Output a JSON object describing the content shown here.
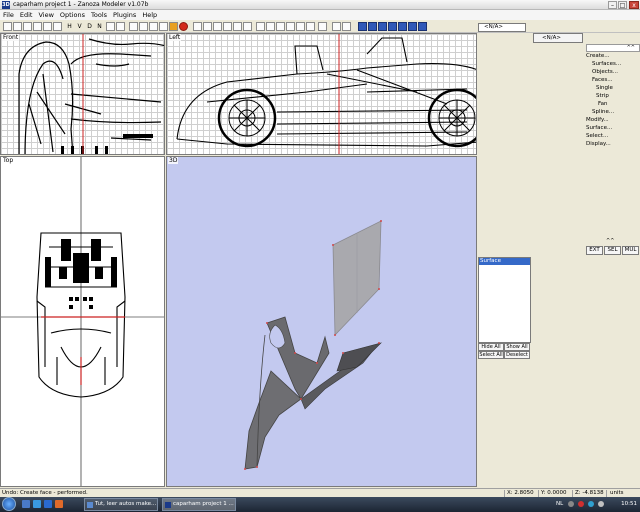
{
  "titlebar": {
    "icon_text": "3D",
    "title": "caparham project 1 - Zanoza Modeler v1.07b",
    "minimize_label": "–",
    "maximize_label": "□",
    "close_label": "x"
  },
  "menu": [
    "File",
    "Edit",
    "View",
    "Options",
    "Tools",
    "Plugins",
    "Help"
  ],
  "toolbar": {
    "plain_labels": [
      "H",
      "V",
      "D",
      "N"
    ],
    "dropdown_value": "<N/A>",
    "dropdown_arrow": "▼"
  },
  "viewports": {
    "front": "Front",
    "left": "Left",
    "top": "Top",
    "three_d": "3D"
  },
  "right_panel": {
    "na_field_1": "<N/A>",
    "na_field_2": "<N/A>",
    "collapse_label": "^^",
    "menu_items": [
      {
        "label": "Create...",
        "level": 0
      },
      {
        "label": "Surfaces...",
        "level": 1
      },
      {
        "label": "Objects...",
        "level": 1
      },
      {
        "label": "Faces...",
        "level": 1
      },
      {
        "label": "Single",
        "level": 2
      },
      {
        "label": "Strip",
        "level": 2
      },
      {
        "label": "Fan",
        "level": 3
      },
      {
        "label": "Spline...",
        "level": 1
      },
      {
        "label": "Modify...",
        "level": 0
      },
      {
        "label": "Surface...",
        "level": 0
      },
      {
        "label": "Select...",
        "level": 0
      },
      {
        "label": "Display...",
        "level": 0
      }
    ],
    "mode_buttons": [
      "EXT",
      "SEL",
      "MUL"
    ],
    "mode_collapse": "^^"
  },
  "surface_panel": {
    "items": [
      "Surface"
    ],
    "buttons": [
      "Hide All",
      "Show All",
      "Select All",
      "Deselect"
    ]
  },
  "status": {
    "message": "Undo: Create face - performed.",
    "x": "X: 2.8050",
    "y": "Y: 0.0000",
    "z": "Z: -4.8138",
    "units": "units"
  },
  "taskbar": {
    "tasks": [
      "Tut, leer autos make...",
      "caparham project 1 ..."
    ],
    "lang": "NL",
    "clock": "10:51"
  },
  "colors": {
    "viewport_3d_bg": "#c3c9ef",
    "selection_blue": "#3569c8",
    "axis_red": "#cc2020"
  }
}
